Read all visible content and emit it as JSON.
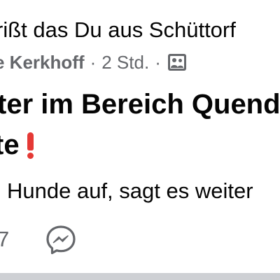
{
  "post": {
    "group_line": "rißt das Du aus Schüttorf",
    "author": "e Kerkhoff",
    "separator": "·",
    "time": "2 Std.",
    "title_line_1": "ter im Bereich Quend",
    "title_line_2": "te",
    "body": "Hunde auf, sagt es weiter",
    "reaction_count": "7"
  },
  "icons": {
    "privacy": "group-privacy-icon",
    "exclamation": "red-exclamation-icon",
    "share": "messenger-icon"
  },
  "colors": {
    "text": "#050505",
    "secondary": "#65676b",
    "alert_red": "#e53935",
    "divider": "#ced0d4"
  }
}
